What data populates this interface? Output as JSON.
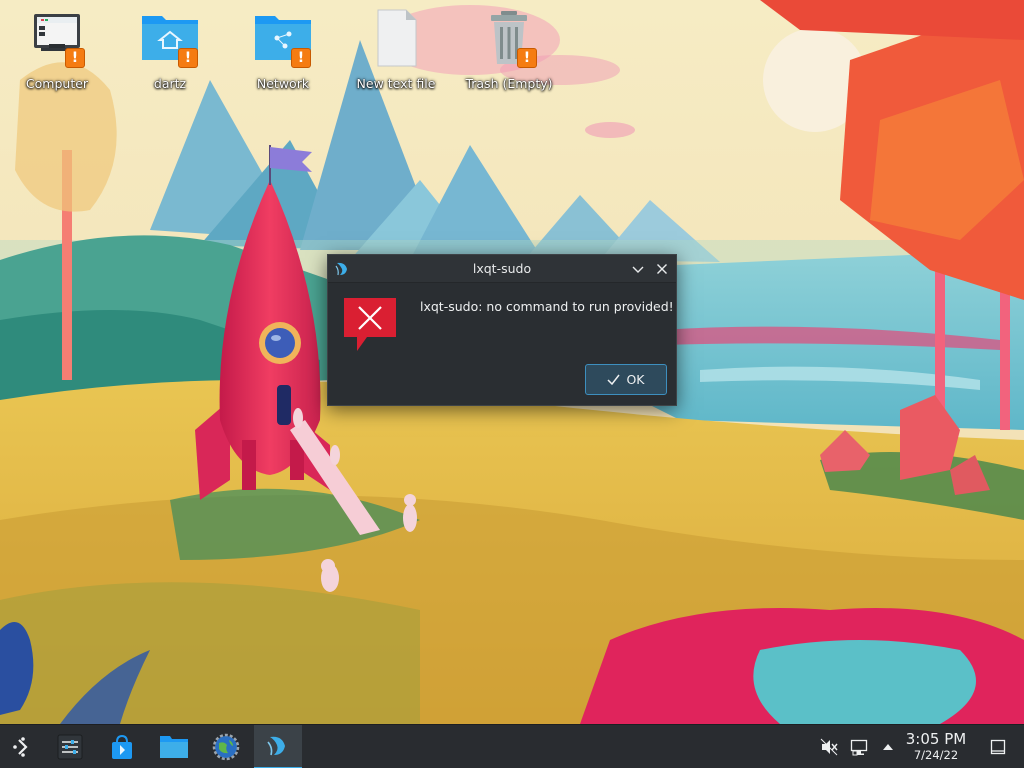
{
  "desktop": {
    "icons": [
      {
        "label": "Computer",
        "icon": "computer-icon"
      },
      {
        "label": "dartz",
        "icon": "home-folder-icon"
      },
      {
        "label": "Network",
        "icon": "network-folder-icon"
      },
      {
        "label": "New text file",
        "icon": "text-file-icon"
      },
      {
        "label": "Trash (Empty)",
        "icon": "trash-icon"
      }
    ]
  },
  "dialog": {
    "title": "lxqt-sudo",
    "message": "lxqt-sudo: no command to run provided!",
    "ok_label": "OK",
    "icon": "error-icon"
  },
  "taskbar": {
    "launcher_icon": "app-launcher-icon",
    "pinned": [
      "system-settings-icon",
      "discover-store-icon",
      "file-manager-icon",
      "browser-icon",
      "lxqt-sudo-icon"
    ],
    "clock": {
      "time": "3:05 PM",
      "date": "7/24/22"
    }
  },
  "colors": {
    "accent": "#3daee9",
    "dialog_bg": "#2a2e32",
    "taskbar_bg": "#292c30",
    "warning_badge": "#f57c12",
    "error_red": "#da1f32"
  }
}
